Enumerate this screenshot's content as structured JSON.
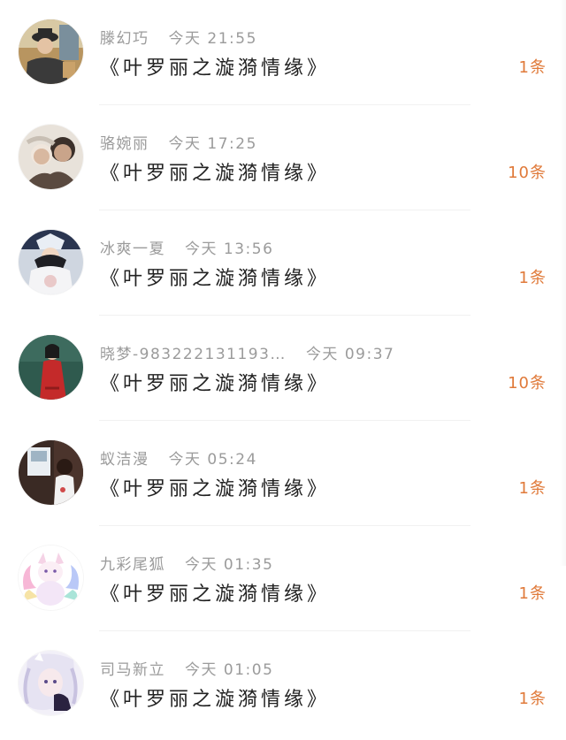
{
  "comments": [
    {
      "name": "滕幻巧",
      "time": "今天 21:55",
      "title": "《叶罗丽之漩漪情缘》",
      "count": "1条",
      "avatar_icon": "avatar-man-in-hat"
    },
    {
      "name": "骆婉丽",
      "time": "今天 17:25",
      "title": "《叶罗丽之漩漪情缘》",
      "count": "10条",
      "avatar_icon": "avatar-couple-photo"
    },
    {
      "name": "冰爽一夏",
      "time": "今天 13:56",
      "title": "《叶罗丽之漩漪情缘》",
      "count": "1条",
      "avatar_icon": "avatar-costume-character"
    },
    {
      "name": "晓梦-983222131193…",
      "time": "今天 09:37",
      "title": "《叶罗丽之漩漪情缘》",
      "count": "10条",
      "avatar_icon": "avatar-woman-red-dress"
    },
    {
      "name": "蚁洁漫",
      "time": "今天 05:24",
      "title": "《叶罗丽之漩漪情缘》",
      "count": "1条",
      "avatar_icon": "avatar-girl-room"
    },
    {
      "name": "九彩尾狐",
      "time": "今天 01:35",
      "title": "《叶罗丽之漩漪情缘》",
      "count": "1条",
      "avatar_icon": "avatar-nine-tailed-fox"
    },
    {
      "name": "司马新立",
      "time": "今天 01:05",
      "title": "《叶罗丽之漩漪情缘》",
      "count": "1条",
      "avatar_icon": "avatar-anime-white-hair"
    }
  ],
  "colors": {
    "name_time_text": "#9b9b9b",
    "title_text": "#222222",
    "count_text": "#e07a3a",
    "divider": "#f1f1f1",
    "background": "#ffffff"
  }
}
